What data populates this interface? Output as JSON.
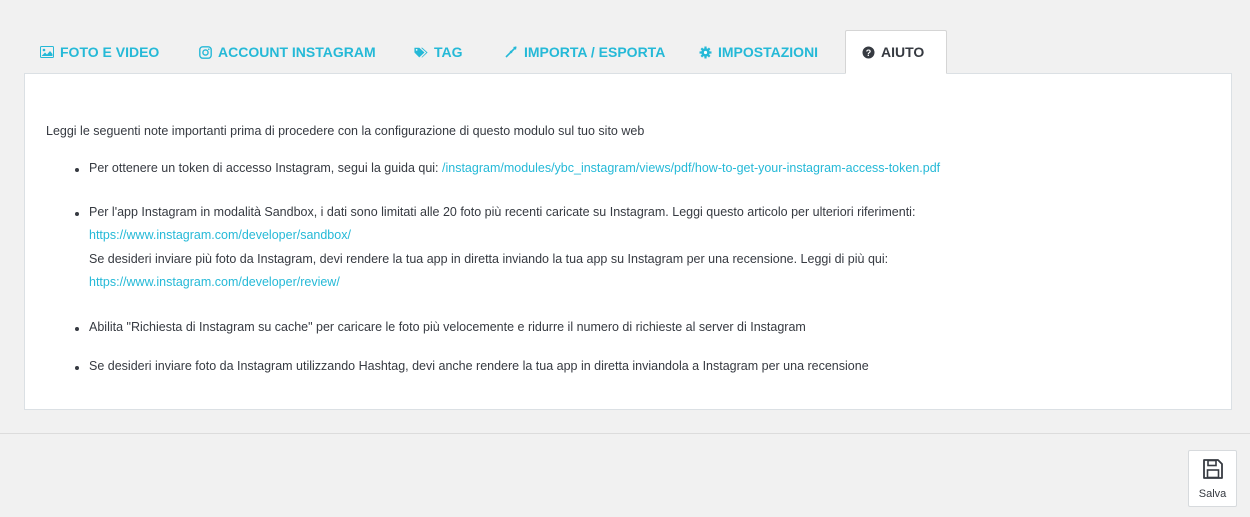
{
  "tabs": [
    {
      "label": "FOTO E VIDEO",
      "icon": "image-icon"
    },
    {
      "label": "ACCOUNT INSTAGRAM",
      "icon": "instagram-icon"
    },
    {
      "label": "TAG",
      "icon": "tag-icon"
    },
    {
      "label": "IMPORTA / ESPORTA",
      "icon": "exchange-icon"
    },
    {
      "label": "IMPOSTAZIONI",
      "icon": "gear-icon"
    },
    {
      "label": "AIUTO",
      "icon": "question-circle-icon"
    }
  ],
  "active_tab": "AIUTO",
  "help": {
    "intro": "Leggi le seguenti note importanti prima di procedere con la configurazione di questo modulo sul tuo sito web",
    "item1_text": "Per ottenere un token di accesso Instagram, segui la guida qui: ",
    "item1_link": "/instagram/modules/ybc_instagram/views/pdf/how-to-get-your-instagram-access-token.pdf",
    "item2_text": "Per l'app Instagram in modalità Sandbox, i dati sono limitati alle 20 foto più recenti caricate su Instagram. Leggi questo articolo per ulteriori riferimenti:",
    "item2_link": "https://www.instagram.com/developer/sandbox/",
    "item2_text2": "Se desideri inviare più foto da Instagram, devi rendere la tua app in diretta inviando la tua app su Instagram per una recensione. Leggi di più qui:",
    "item2_link2": "https://www.instagram.com/developer/review/",
    "item3_text": "Abilita \"Richiesta di Instagram su cache\" per caricare le foto più velocemente e ridurre il numero di richieste al server di Instagram",
    "item4_text": "Se desideri inviare foto da Instagram utilizzando Hashtag, devi anche rendere la tua app in diretta inviandola a Instagram per una recensione"
  },
  "footer": {
    "save_label": "Salva"
  },
  "colors": {
    "accent": "#25b9d7",
    "text": "#363a41",
    "background": "#f1f1f1"
  }
}
